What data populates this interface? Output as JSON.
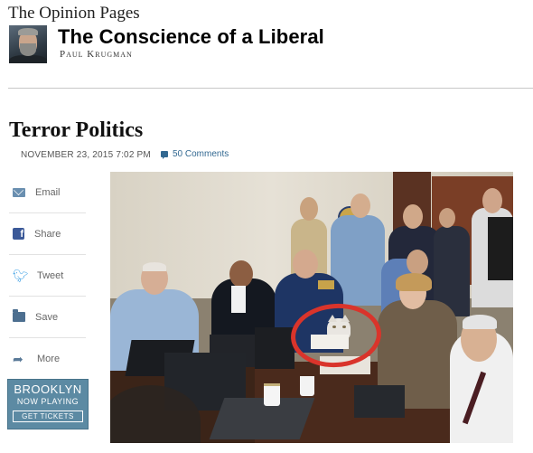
{
  "header": {
    "section": "The Opinion Pages",
    "blog_title": "The Conscience of a Liberal",
    "author": "Paul Krugman"
  },
  "article": {
    "title": "Terror Politics",
    "dateline": "NOVEMBER 23, 2015 7:02 PM",
    "comments": "50 Comments"
  },
  "share_tools": [
    {
      "label": "Email",
      "icon": "email-icon"
    },
    {
      "label": "Share",
      "icon": "facebook-icon"
    },
    {
      "label": "Tweet",
      "icon": "twitter-icon"
    },
    {
      "label": "Save",
      "icon": "save-folder-icon"
    },
    {
      "label": "More",
      "icon": "share-arrow-icon"
    }
  ],
  "ad": {
    "title": "BROOKLYN",
    "subtitle": "NOW PLAYING",
    "button": "GET TICKETS",
    "color": "#5c8aa3"
  },
  "colors": {
    "link": "#326891",
    "annotation_circle": "#d9342b"
  }
}
